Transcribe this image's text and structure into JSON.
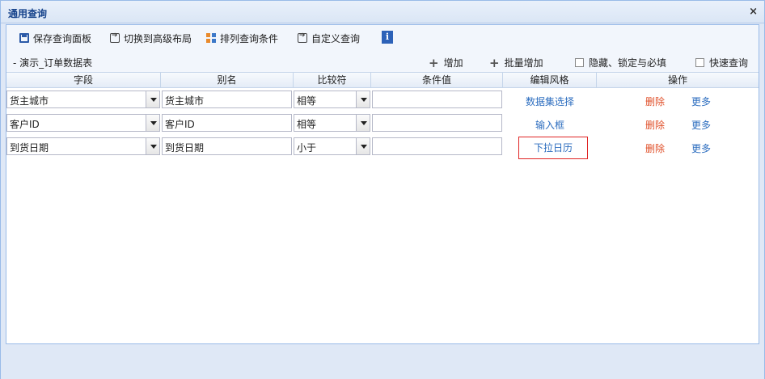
{
  "window": {
    "title": "通用查询",
    "close": "×"
  },
  "toolbar": {
    "save_label": "保存查询面板",
    "switch_label": "切换到高级布局",
    "sort_label": "排列查询条件",
    "custom_label": "自定义查询",
    "info_label": "i"
  },
  "grid": {
    "table_title": "- 演示_订单数据表",
    "add_label": "增加",
    "batch_add_label": "批量增加",
    "hide_lock_label": "隐藏、锁定与必填",
    "quick_query_label": "快速查询",
    "columns": [
      "字段",
      "别名",
      "比较符",
      "条件值",
      "编辑风格",
      "操作"
    ],
    "rows": [
      {
        "field": "货主城市",
        "alias": "货主城市",
        "compare": "相等",
        "value": "",
        "style": "数据集选择",
        "delete": "删除",
        "more": "更多"
      },
      {
        "field": "客户ID",
        "alias": "客户ID",
        "compare": "相等",
        "value": "",
        "style": "输入框",
        "delete": "删除",
        "more": "更多"
      },
      {
        "field": "到货日期",
        "alias": "到货日期",
        "compare": "小于",
        "value": "",
        "style": "下拉日历",
        "delete": "删除",
        "more": "更多"
      }
    ]
  },
  "icons": {
    "save": "save-icon",
    "switch": "switch-layout-icon",
    "sort": "sort-icon",
    "custom": "custom-query-icon",
    "info": "info-icon"
  }
}
